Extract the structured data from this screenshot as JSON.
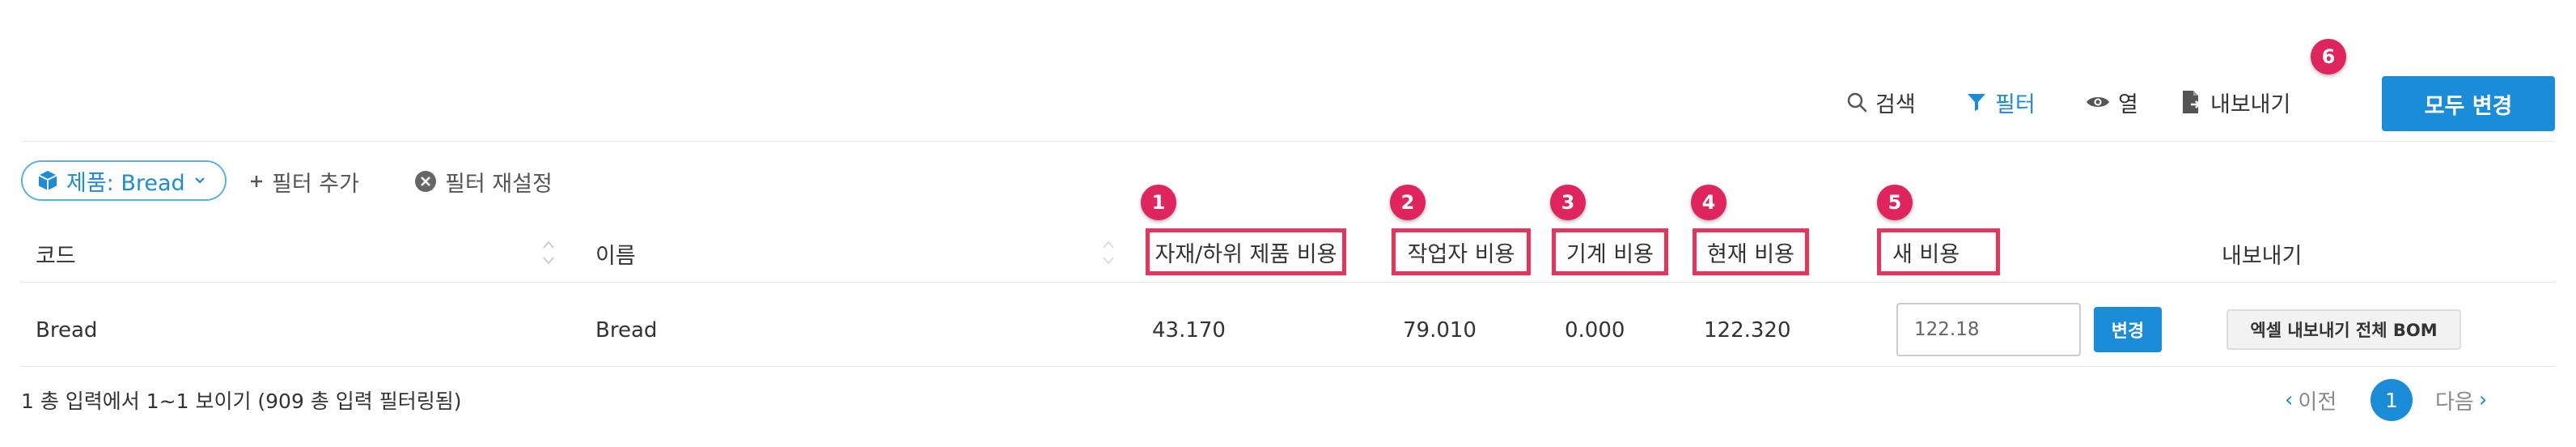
{
  "toolbar": {
    "search_label": "검색",
    "filter_label": "필터",
    "columns_label": "열",
    "export_label": "내보내기",
    "change_all_label": "모두 변경"
  },
  "filters": {
    "product_chip_label": "제품: Bread",
    "add_filter_label": "필터 추가",
    "reset_filter_label": "필터 재설정"
  },
  "table": {
    "headers": {
      "code": "코드",
      "name": "이름",
      "material_cost": "자재/하위 제품 비용",
      "labor_cost": "작업자 비용",
      "machine_cost": "기계 비용",
      "current_cost": "현재 비용",
      "new_cost": "새 비용",
      "export": "내보내기"
    },
    "rows": [
      {
        "code": "Bread",
        "name": "Bread",
        "material_cost": "43.170",
        "labor_cost": "79.010",
        "machine_cost": "0.000",
        "current_cost": "122.320",
        "new_cost_value": "122.18",
        "change_button": "변경",
        "export_button": "엑셀 내보내기 전체 BOM"
      }
    ]
  },
  "badges": [
    "1",
    "2",
    "3",
    "4",
    "5",
    "6"
  ],
  "footer": {
    "summary": "1 총 입력에서 1~1 보이기 (909 총 입력 필터링됨)",
    "prev_label": "이전",
    "current_page": "1",
    "next_label": "다음"
  },
  "colors": {
    "accent": "#1a8cd8",
    "highlight": "#e8335c",
    "badge": "#e0245e"
  }
}
